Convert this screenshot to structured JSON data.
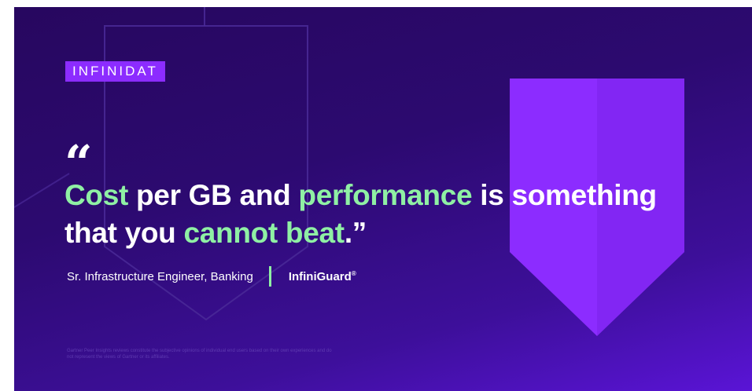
{
  "brand": {
    "logo_text": "INFINIDAT"
  },
  "quote": {
    "open_mark": "“",
    "segments": [
      {
        "text": "Cost",
        "highlight": true
      },
      {
        "text": " per GB and ",
        "highlight": false
      },
      {
        "text": "performance",
        "highlight": true
      },
      {
        "text": " is something that you ",
        "highlight": false
      },
      {
        "text": "cannot beat",
        "highlight": true
      },
      {
        "text": ".”",
        "highlight": false
      }
    ]
  },
  "attribution": {
    "role": "Sr. Infrastructure Engineer, Banking",
    "product": "InfiniGuard",
    "product_mark": "®"
  },
  "disclaimer": "Gartner Peer Insights reviews constitute the subjective opinions of individual end users based on their own experiences and do not represent the views of Gartner or its affiliates.",
  "colors": {
    "background": "#2c0a70",
    "accent_green": "#8ff0a4",
    "accent_purple": "#8c2cff"
  }
}
